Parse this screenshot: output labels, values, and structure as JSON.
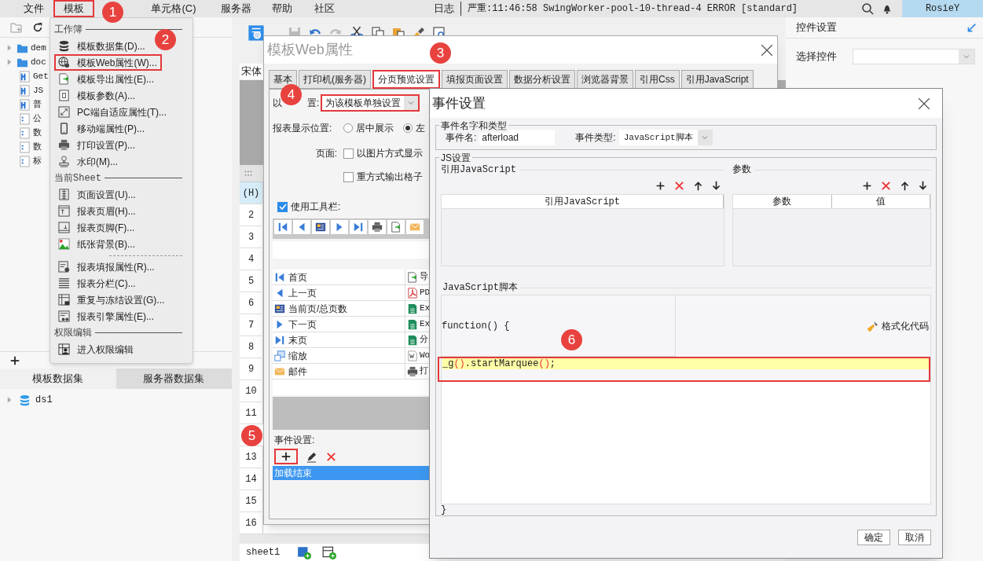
{
  "menubar": {
    "items": [
      {
        "label": "文件",
        "highlighted": false
      },
      {
        "label": "模板",
        "highlighted": true
      },
      {
        "label": "单元格(C)",
        "highlighted": false
      },
      {
        "label": "服务器",
        "highlighted": false
      },
      {
        "label": "帮助",
        "highlighted": false
      },
      {
        "label": "社区",
        "highlighted": false
      }
    ],
    "log_label": "日志",
    "log_message": "严重:11:46:58 SwingWorker-pool-10-thread-4 ERROR [standard]",
    "user": "RosieY"
  },
  "file_tree": [
    {
      "kind": "folder",
      "label": "dem"
    },
    {
      "kind": "folder",
      "label": "doc"
    },
    {
      "kind": "report",
      "label": "Get"
    },
    {
      "kind": "report",
      "label": "JS"
    },
    {
      "kind": "report",
      "label": "普"
    },
    {
      "kind": "form",
      "label": "公"
    },
    {
      "kind": "form",
      "label": "数"
    },
    {
      "kind": "form",
      "label": "数"
    },
    {
      "kind": "form",
      "label": "标"
    }
  ],
  "dataset_tabs": [
    {
      "label": "模板数据集",
      "selected": true
    },
    {
      "label": "服务器数据集",
      "selected": false
    }
  ],
  "datasets": [
    {
      "label": "ds1"
    }
  ],
  "template_menu": [
    {
      "title": "工作簿",
      "items": [
        {
          "label": "模板数据集(D)...",
          "highlighted": false
        },
        {
          "label": "模板Web属性(W)...",
          "highlighted": true
        },
        {
          "label": "模板导出属性(E)...",
          "highlighted": false
        },
        {
          "label": "模板参数(A)...",
          "highlighted": false
        },
        {
          "label": "PC端自适应属性(T)...",
          "highlighted": false
        },
        {
          "label": "移动端属性(P)...",
          "highlighted": false
        },
        {
          "label": "打印设置(P)...",
          "highlighted": false
        },
        {
          "label": "水印(M)...",
          "highlighted": false
        }
      ]
    },
    {
      "title": "当前Sheet",
      "items": [
        {
          "label": "页面设置(U)...",
          "highlighted": false
        },
        {
          "label": "报表页眉(H)...",
          "highlighted": false
        },
        {
          "label": "报表页脚(F)...",
          "highlighted": false
        },
        {
          "label": "纸张背景(B)...",
          "highlighted": false
        },
        {
          "label": "报表填报属性(R)...",
          "highlighted": false,
          "separator_before": true
        },
        {
          "label": "报表分栏(C)...",
          "highlighted": false
        },
        {
          "label": "重复与冻结设置(G)...",
          "highlighted": false
        },
        {
          "label": "报表引擎属性(E)...",
          "highlighted": false
        }
      ]
    },
    {
      "title": "权限编辑",
      "items": [
        {
          "label": "进入权限编辑",
          "highlighted": false
        }
      ]
    }
  ],
  "sheet": {
    "font": "宋体",
    "row_headers": [
      "(H)",
      "2",
      "3",
      "4",
      "5",
      "6",
      "7",
      "8",
      "9",
      "10",
      "11",
      "13",
      "14",
      "15",
      "16"
    ],
    "sheet_tabs": [
      {
        "label": "sheet1",
        "selected": true
      }
    ]
  },
  "web_dialog": {
    "title": "模板Web属性",
    "tabs": [
      {
        "label": "基本",
        "selected": false
      },
      {
        "label": "打印机(服务器)",
        "selected": false
      },
      {
        "label": "分页预览设置",
        "selected": true
      },
      {
        "label": "填报页面设置",
        "selected": false
      },
      {
        "label": "数据分析设置",
        "selected": false
      },
      {
        "label": "浏览器背景",
        "selected": false
      },
      {
        "label": "引用Css",
        "selected": false
      },
      {
        "label": "引用JavaScript",
        "selected": false
      }
    ],
    "scope_label_start": "以",
    "scope_label_end": "置:",
    "scope_select": {
      "value": "为该模板单独设置",
      "highlighted": true
    },
    "position_label": "报表显示位置:",
    "position_options": [
      {
        "label": "居中展示",
        "selected": false
      },
      {
        "label": "左",
        "selected": true
      }
    ],
    "page_label": "页面:",
    "page_options": [
      {
        "label": "以图片方式显示",
        "checked": false
      },
      {
        "label": "重方式输出格子",
        "checked": false
      }
    ],
    "toolbar_option": {
      "label": "使用工具栏:",
      "checked": true
    },
    "buttons_left": [
      {
        "label": "首页"
      },
      {
        "label": "上一页"
      },
      {
        "label": "当前页/总页数"
      },
      {
        "label": "下一页"
      },
      {
        "label": "末页"
      },
      {
        "label": "缩放"
      },
      {
        "label": "邮件"
      }
    ],
    "buttons_right": [
      {
        "label": "导"
      },
      {
        "label": "PD"
      },
      {
        "label": "Ex"
      },
      {
        "label": "Ex"
      },
      {
        "label": "分"
      },
      {
        "label": "Wo"
      },
      {
        "label": "打"
      }
    ],
    "events_label": "事件设置:",
    "add_button": {
      "highlighted": true
    },
    "events": [
      {
        "label": "加载结束",
        "selected": true
      }
    ]
  },
  "event_dialog": {
    "title": "事件设置",
    "name_group": "事件名字和类型",
    "name_label": "事件名:",
    "name_value": "afterload",
    "type_label": "事件类型:",
    "type_value": "JavaScript脚本",
    "js_group": "JS设置",
    "ref_section": "引用JavaScript",
    "ref_columns": [
      "引用JavaScript"
    ],
    "param_section": "参数",
    "param_columns": [
      "参数",
      "值"
    ],
    "script_section": "JavaScript脚本",
    "code_start": "function() {",
    "format_button": "格式化代码",
    "code_lines": [
      {
        "text": "_g().startMarquee();",
        "highlighted": true
      }
    ],
    "code_end": "}",
    "buttons": [
      "确定",
      "取消"
    ]
  },
  "right_panel": {
    "title": "控件设置",
    "select_label": "选择控件"
  },
  "badges": [
    "1",
    "2",
    "3",
    "4",
    "5",
    "6"
  ]
}
